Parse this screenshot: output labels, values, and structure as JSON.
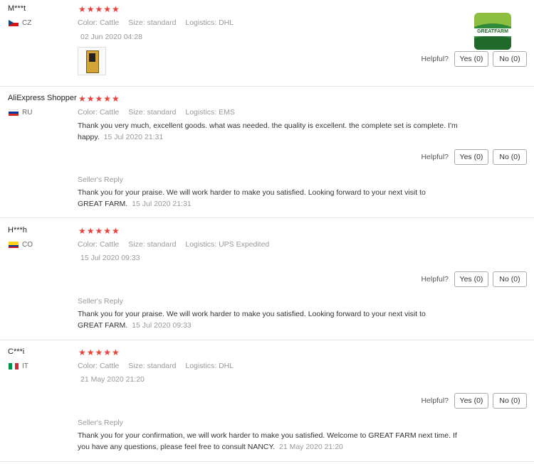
{
  "helpful_label": "Helpful?",
  "seller_reply_label": "Seller's Reply",
  "field_labels": {
    "color": "Color:",
    "size": "Size:",
    "logistics": "Logistics:"
  },
  "logo_text": "GREATFARM",
  "reviews": [
    {
      "user": "M***t",
      "country": "CZ",
      "stars": "★★★★★",
      "color": "Cattle",
      "size": "standard",
      "logistics": "DHL",
      "date": "02 Jun 2020 04:28",
      "yes": "Yes (0)",
      "no": "No (0)"
    },
    {
      "user": "AliExpress Shopper",
      "country": "RU",
      "stars": "★★★★★",
      "color": "Cattle",
      "size": "standard",
      "logistics": "EMS",
      "text": "Thank you very much, excellent goods. what was needed. the quality is excellent. the complete set is complete. I'm happy.",
      "date": "15 Jul 2020 21:31",
      "yes": "Yes (0)",
      "no": "No (0)",
      "reply_text": "Thank you for your praise. We will work harder to make you satisfied. Looking forward to your next visit to GREAT FARM.",
      "reply_date": "15 Jul 2020 21:31"
    },
    {
      "user": "H***h",
      "country": "CO",
      "stars": "★★★★★",
      "color": "Cattle",
      "size": "standard",
      "logistics": "UPS Expedited",
      "date": "15 Jul 2020 09:33",
      "yes": "Yes (0)",
      "no": "No (0)",
      "reply_text": "Thank you for your praise. We will work harder to make you satisfied. Looking forward to your next visit to GREAT FARM.",
      "reply_date": "15 Jul 2020 09:33"
    },
    {
      "user": "C***i",
      "country": "IT",
      "stars": "★★★★★",
      "color": "Cattle",
      "size": "standard",
      "logistics": "DHL",
      "date": "21 May 2020 21:20",
      "yes": "Yes (0)",
      "no": "No (0)",
      "reply_text": "Thank you for your confirmation, we will work harder to make you satisfied. Welcome to GREAT FARM next time. If you have any questions, please feel free to consult NANCY.",
      "reply_date": "21 May 2020 21:20"
    }
  ]
}
